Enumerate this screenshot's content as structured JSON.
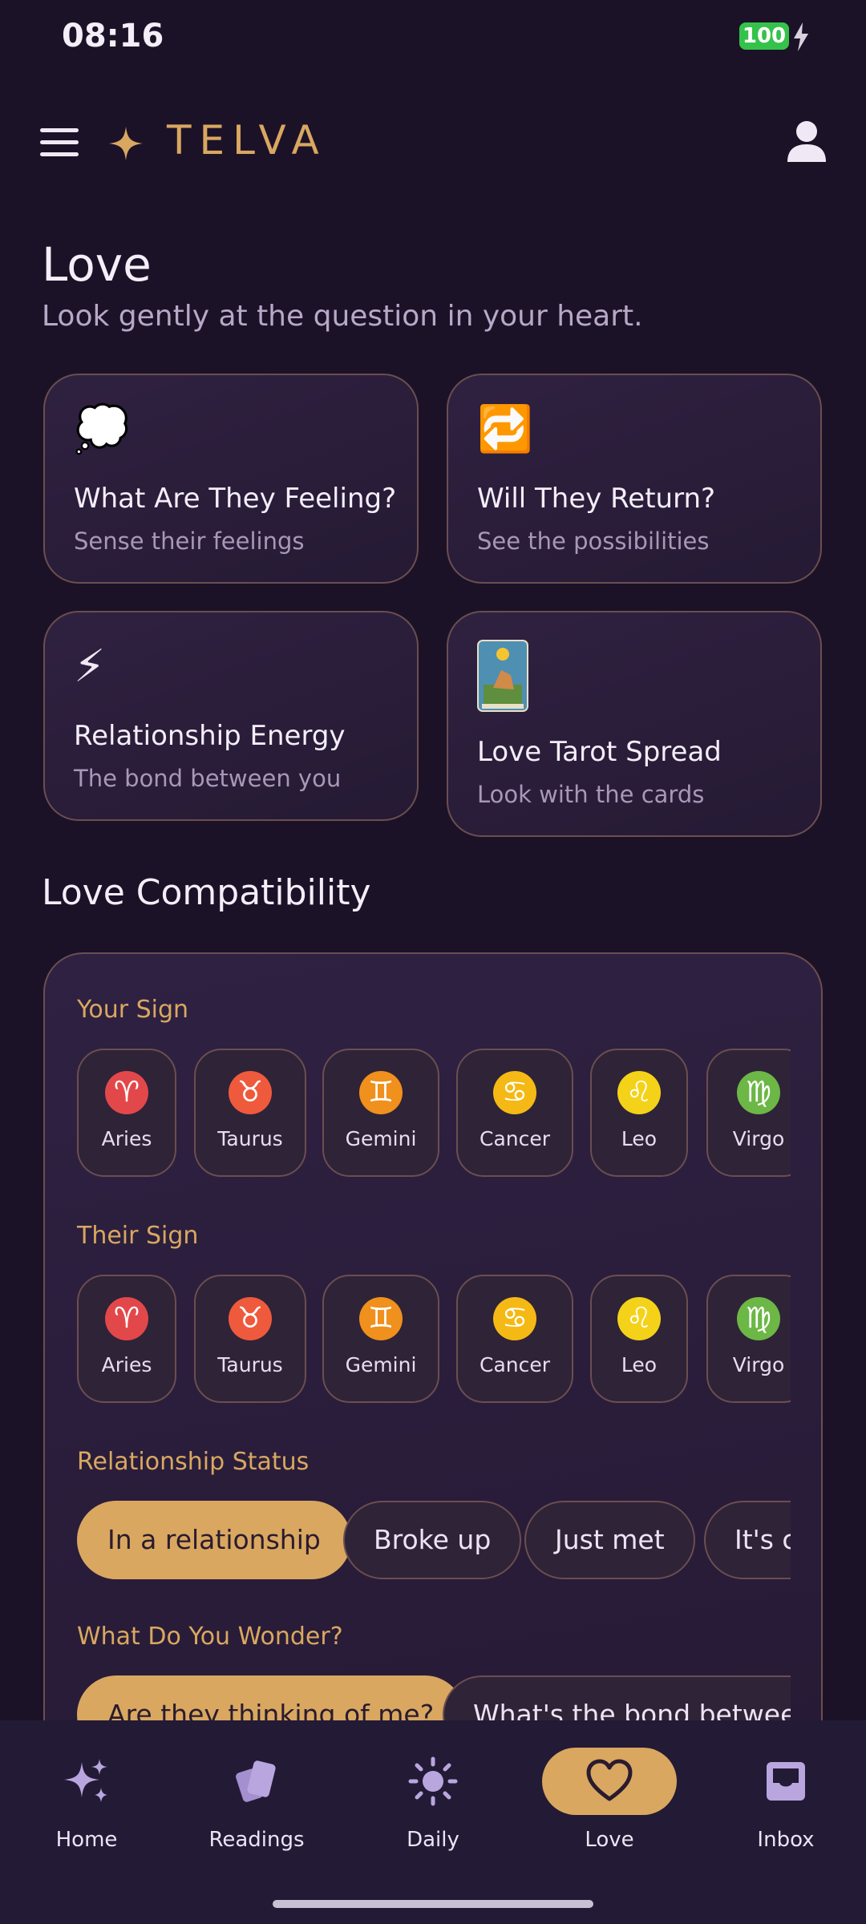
{
  "status_bar": {
    "time": "08:16",
    "battery": "100"
  },
  "header": {
    "logo": "TELVA"
  },
  "page": {
    "title": "Love",
    "subtitle": "Look gently at the question in your heart."
  },
  "cards": [
    {
      "emoji": "💭",
      "title": "What Are They Feeling?",
      "subtitle": "Sense their feelings"
    },
    {
      "emoji": "🔁",
      "title": "Will They Return?",
      "subtitle": "See the possibilities"
    },
    {
      "emoji": "⚡",
      "title": "Relationship Energy",
      "subtitle": "The bond between you"
    },
    {
      "emoji": "🃏",
      "title": "Love Tarot Spread",
      "subtitle": "Look with the cards"
    }
  ],
  "compatibility": {
    "title": "Love Compatibility",
    "your_sign_label": "Your Sign",
    "their_sign_label": "Their Sign",
    "status_label": "Relationship Status",
    "wonder_label": "What Do You Wonder?",
    "signs": [
      {
        "name": "Aries",
        "glyph": "♈",
        "color": "#e2484a"
      },
      {
        "name": "Taurus",
        "glyph": "♉",
        "color": "#ef5a3c"
      },
      {
        "name": "Gemini",
        "glyph": "♊",
        "color": "#f0901d"
      },
      {
        "name": "Cancer",
        "glyph": "♋",
        "color": "#f5b915"
      },
      {
        "name": "Leo",
        "glyph": "♌",
        "color": "#f4d219"
      },
      {
        "name": "Virgo",
        "glyph": "♍",
        "color": "#6cb746"
      }
    ],
    "statuses": [
      "In a relationship",
      "Broke up",
      "Just met",
      "It's complicated"
    ],
    "active_status": "In a relationship",
    "wonders": [
      "Are they thinking of me?",
      "What's the bond between us?"
    ],
    "active_wonder": "Are they thinking of me?"
  },
  "nav": {
    "items": [
      {
        "label": "Home",
        "icon": "sparkles-icon"
      },
      {
        "label": "Readings",
        "icon": "cards-icon"
      },
      {
        "label": "Daily",
        "icon": "sun-icon"
      },
      {
        "label": "Love",
        "icon": "heart-icon"
      },
      {
        "label": "Inbox",
        "icon": "inbox-icon"
      }
    ],
    "active": "Love"
  },
  "colors": {
    "accent": "#d9a760",
    "background": "#1c1228",
    "card_border": "#6b4e4f"
  }
}
